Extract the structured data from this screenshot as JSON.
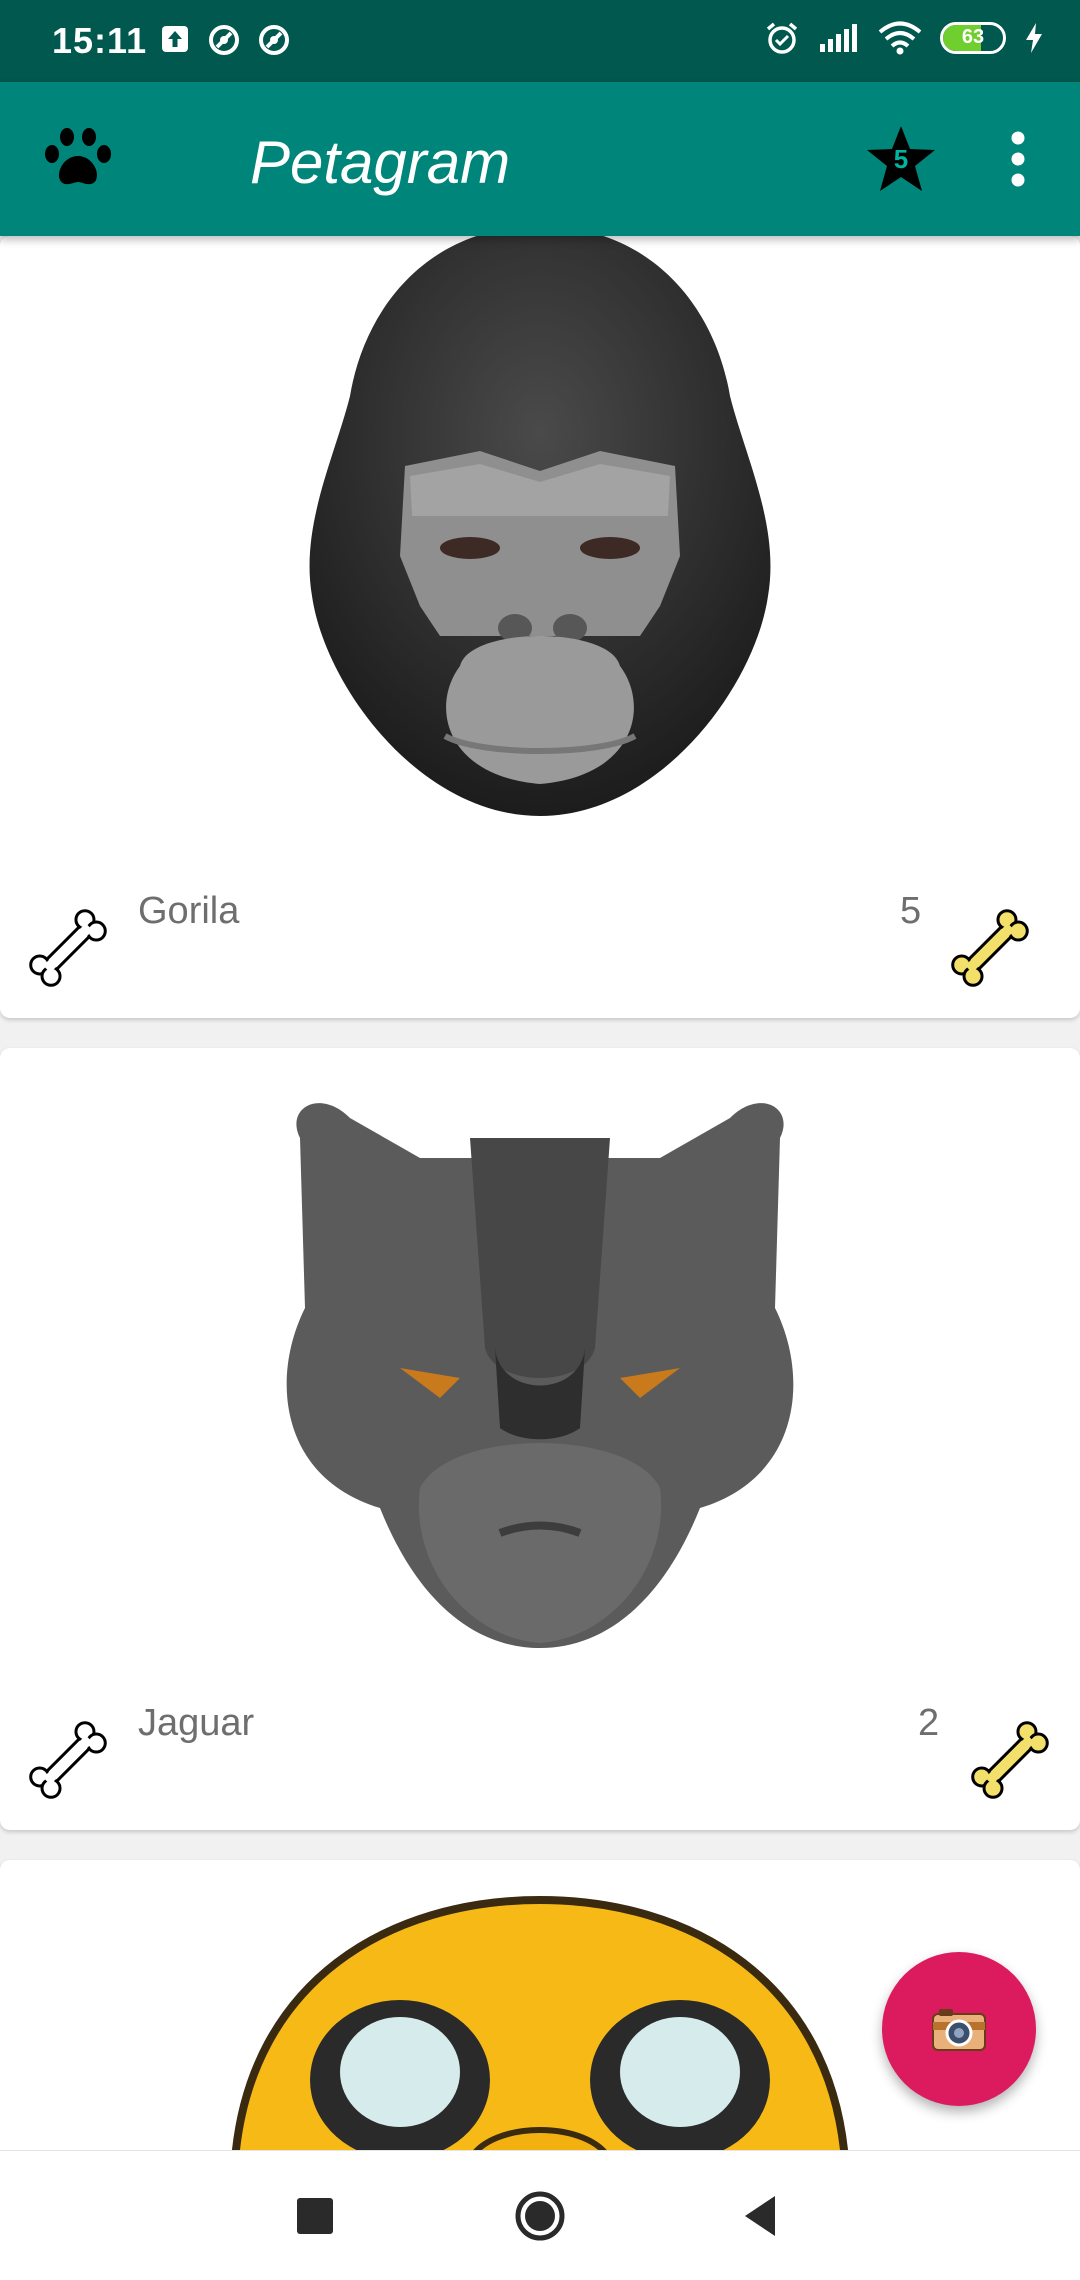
{
  "status_bar": {
    "time": "15:11",
    "battery_level": "63",
    "battery_fraction": 0.63,
    "icons": [
      "upload-icon",
      "sync-icon",
      "sync-icon",
      "alarm-icon",
      "signal-icon",
      "wifi-icon",
      "battery-icon",
      "charging-icon"
    ]
  },
  "app_bar": {
    "title": "Petagram",
    "star_count": "5",
    "icons": [
      "paw-icon",
      "star-icon",
      "more-vert-icon"
    ]
  },
  "pets": [
    {
      "name": "Gorila",
      "likes": "5",
      "image": "gorilla-face-image"
    },
    {
      "name": "Jaguar",
      "likes": "2",
      "image": "jaguar-face-image"
    },
    {
      "name": "",
      "likes": "",
      "image": "yellow-dog-face-image"
    }
  ],
  "fab": {
    "icon": "camera-icon",
    "color": "#dc1b5e"
  },
  "nav_bar": {
    "icons": [
      "recents-square-icon",
      "home-circle-icon",
      "back-triangle-icon"
    ]
  },
  "colors": {
    "status_bar": "#00584f",
    "app_bar": "#00857a",
    "bone_yellow": "#f2e06b"
  }
}
